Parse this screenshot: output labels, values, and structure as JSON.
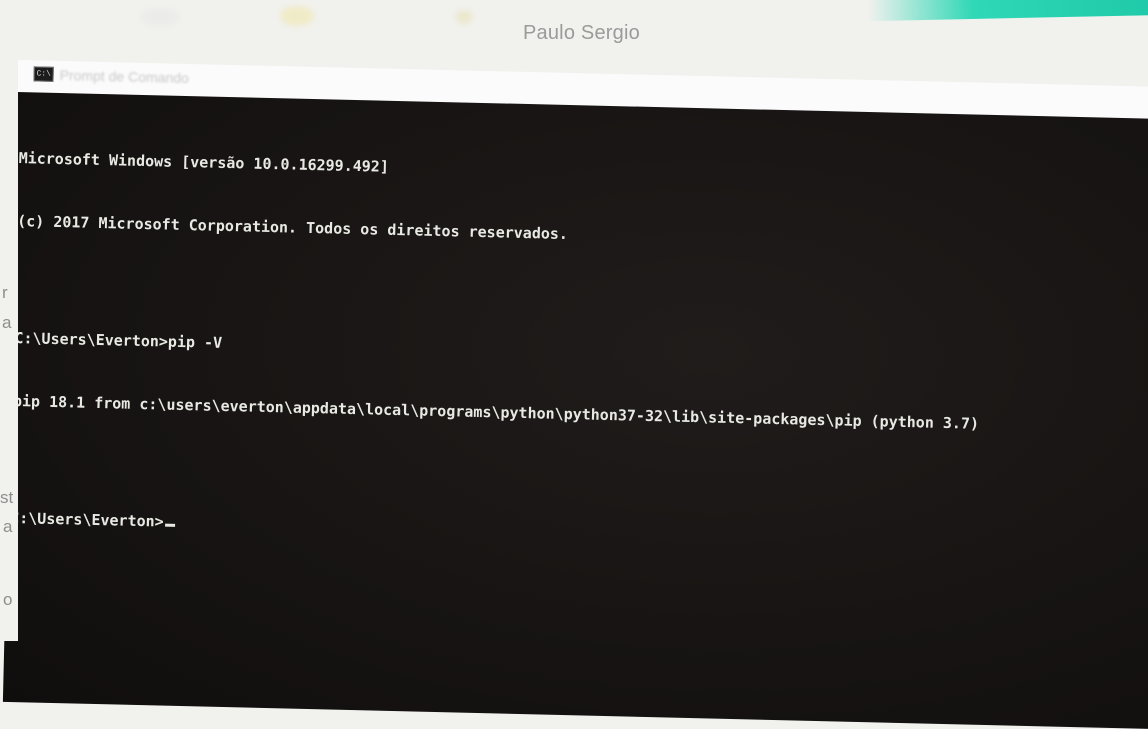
{
  "browser": {
    "user_name": "Paulo Sergio"
  },
  "window": {
    "title": "Prompt de Comando",
    "icon": "cmd-icon"
  },
  "console": {
    "lines": [
      "Microsoft Windows [versão 10.0.16299.492]",
      "(c) 2017 Microsoft Corporation. Todos os direitos reservados.",
      "",
      "C:\\Users\\Everton>pip -V",
      "pip 18.1 from c:\\users\\everton\\appdata\\local\\programs\\python\\python37-32\\lib\\site-packages\\pip (python 3.7)",
      "",
      "C:\\Users\\Everton>"
    ]
  },
  "background_fragments": [
    "r",
    "a",
    "st",
    "a",
    "o"
  ],
  "colors": {
    "console_bg": "#171413",
    "console_fg": "#e9e9e4",
    "accent_teal": "#2fd8b6"
  }
}
